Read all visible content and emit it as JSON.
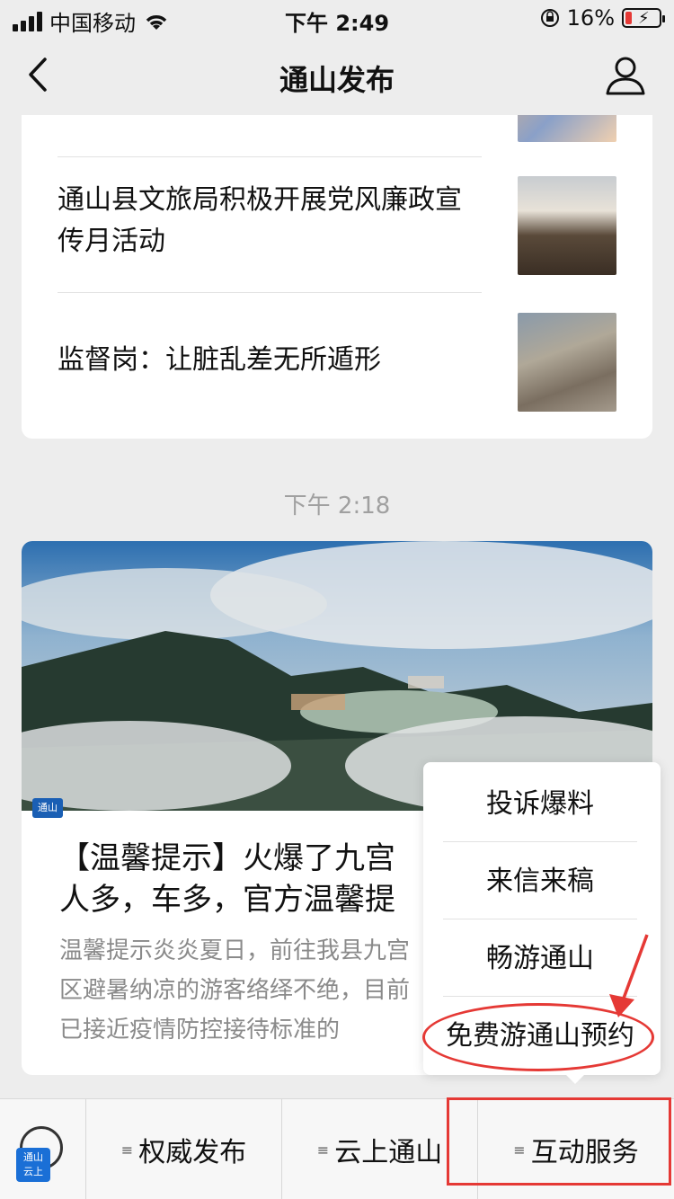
{
  "status_bar": {
    "carrier": "中国移动",
    "time": "下午 2:49",
    "battery": "16%"
  },
  "nav": {
    "title": "通山发布"
  },
  "articles_top": [
    {
      "title": "通山县文旅局积极开展党风廉政宣传月活动"
    },
    {
      "title": "监督岗：让脏乱差无所遁形"
    }
  ],
  "timestamp": "下午 2:18",
  "feature": {
    "headline": "【温馨提示】火爆了九宫人多，车多，官方温馨提",
    "headline_line1": "【温馨提示】火爆了九宫",
    "headline_line2": "人多，车多，官方温馨提",
    "summary_line1": "温馨提示炎炎夏日，前往我县九宫",
    "summary_line2": "区避暑纳凉的游客络绎不绝，目前",
    "summary_line3": "已接近疫情防控接待标准的",
    "watermark": "通山"
  },
  "popup_menu": {
    "items": [
      "投诉爆料",
      "来信来稿",
      "畅游通山",
      "免费游通山预约"
    ]
  },
  "bottom_menu": {
    "logo_top": "通山",
    "logo_bottom": "云上",
    "items": [
      "权威发布",
      "云上通山",
      "互动服务"
    ]
  },
  "colors": {
    "highlight": "#e53935",
    "background": "#ededed"
  }
}
